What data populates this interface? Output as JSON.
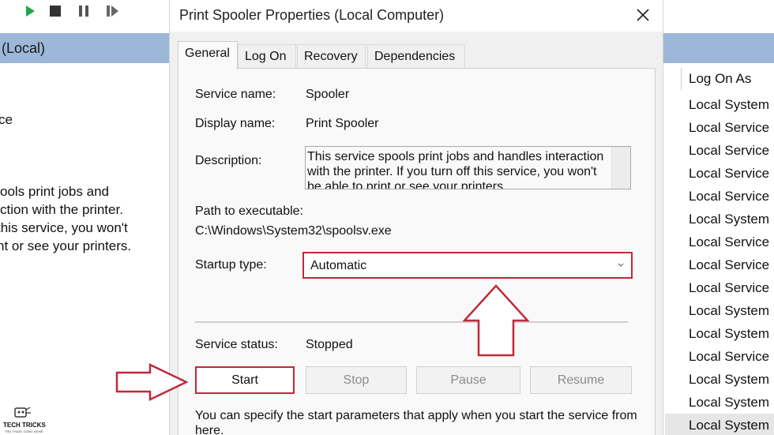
{
  "background": {
    "header_label": "(Local)",
    "left_text": [
      "ce",
      "ools print jobs and",
      "ction with the printer.",
      " this service, you won't",
      "nt or see your printers."
    ],
    "log_on_as_header": "Log On As",
    "log_on_rows": [
      "Local System",
      "Local Service",
      "Local Service",
      "Local Service",
      "Local Service",
      "Local System",
      "Local Service",
      "Local Service",
      "Local Service",
      "Local System",
      "Local System",
      "Local Service",
      "Local System",
      "Local System",
      "Local System"
    ],
    "toolbar_icons": [
      "play-icon",
      "stop-icon",
      "pause-icon",
      "resume-icon"
    ],
    "logo": {
      "title": "TECH TRICKS",
      "subtitle": "THỦ THUẬT CÔNG NGHỆ"
    }
  },
  "dialog": {
    "title": "Print Spooler Properties (Local Computer)",
    "tabs": [
      {
        "label": "General",
        "active": true
      },
      {
        "label": "Log On",
        "active": false
      },
      {
        "label": "Recovery",
        "active": false
      },
      {
        "label": "Dependencies",
        "active": false
      }
    ],
    "service_name_label": "Service name:",
    "service_name": "Spooler",
    "display_name_label": "Display name:",
    "display_name": "Print Spooler",
    "description_label": "Description:",
    "description": "This service spools print jobs and handles interaction with the printer.  If you turn off this service, you won't be able to print or see your printers.",
    "path_label": "Path to executable:",
    "path": "C:\\Windows\\System32\\spoolsv.exe",
    "startup_type_label": "Startup type:",
    "startup_type": "Automatic",
    "service_status_label": "Service status:",
    "service_status": "Stopped",
    "buttons": {
      "start": "Start",
      "stop": "Stop",
      "pause": "Pause",
      "resume": "Resume"
    },
    "footer_text": "You can specify the start parameters that apply when you start the service from here."
  },
  "colors": {
    "highlight": "#c0283a",
    "header_blue": "#9db7d9",
    "play_green": "#1fa84a"
  }
}
